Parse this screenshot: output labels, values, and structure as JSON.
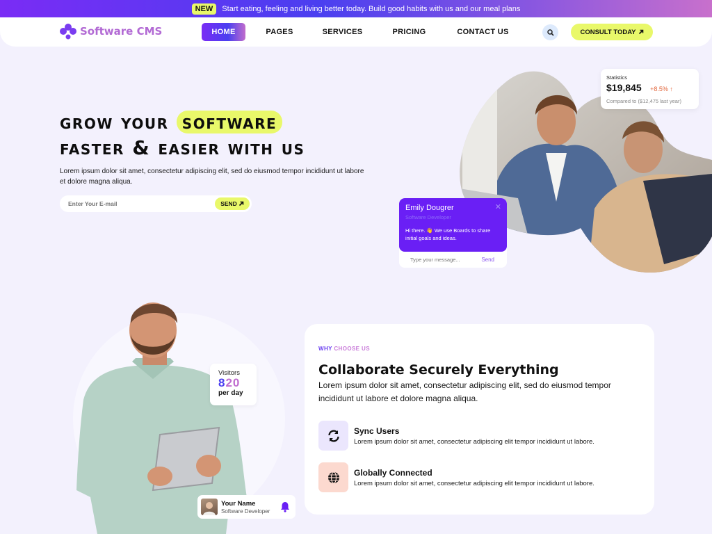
{
  "announcement": {
    "badge": "NEW",
    "text": "Start eating, feeling and living better today. Build good habits with us and our meal plans"
  },
  "brand": {
    "name": "Software CMS",
    "icon": "flower-logo-icon"
  },
  "nav": {
    "items": [
      {
        "label": "HOME",
        "active": true
      },
      {
        "label": "PAGES",
        "active": false
      },
      {
        "label": "SERVICES",
        "active": false
      },
      {
        "label": "PRICING",
        "active": false
      },
      {
        "label": "CONTACT US",
        "active": false
      }
    ],
    "search_icon": "search-icon",
    "cta_label": "CONSULT TODAY",
    "cta_icon": "arrow-up-right-icon"
  },
  "hero": {
    "title_line1_prefix": "Grow your ",
    "title_highlight": "software",
    "title_line2": "faster & easier with us",
    "description": "Lorem ipsum dolor sit amet, consectetur adipiscing elit, sed do eiusmod tempor incididunt ut labore et dolore magna aliqua.",
    "email_placeholder": "Enter Your E-mail",
    "send_label": "SEND"
  },
  "stats_card": {
    "label": "Statistics",
    "value": "$19,845",
    "change": "+8.5%",
    "compare": "Compared to ($12,475 last year)"
  },
  "chat_card": {
    "name": "Emily Dougrer",
    "role": "Software Developer",
    "message": "Hi there. 👋 We use Boards to share initial goals and ideas.",
    "input_placeholder": "Type your message...",
    "send_label": "Send"
  },
  "visitors_card": {
    "label": "Visitors",
    "value_part1": "8",
    "value_part2": "20",
    "unit": "per day"
  },
  "profile_card": {
    "name": "Your Name",
    "role": "Software Developer"
  },
  "why": {
    "eyebrow_part1": "WHY ",
    "eyebrow_part2": "CHOOSE US",
    "title": "Collaborate Securely Everything",
    "description": "Lorem ipsum dolor sit amet, consectetur adipiscing elit, sed do eiusmod tempor incididunt ut labore et dolore magna aliqua.",
    "features": [
      {
        "title": "Sync Users",
        "desc": "Lorem ipsum dolor sit amet, consectetur adipiscing elit tempor incididunt ut labore.",
        "icon": "sync-icon",
        "color": "#ebe6fd"
      },
      {
        "title": "Globally Connected",
        "desc": "Lorem ipsum dolor sit amet, consectetur adipiscing elit tempor incididunt ut labore.",
        "icon": "globe-icon",
        "color": "#fcd9cf"
      }
    ]
  },
  "colors": {
    "accent_purple": "#6a1ff5",
    "accent_yellow": "#e9f86a",
    "page_bg": "#f3f1fd"
  }
}
